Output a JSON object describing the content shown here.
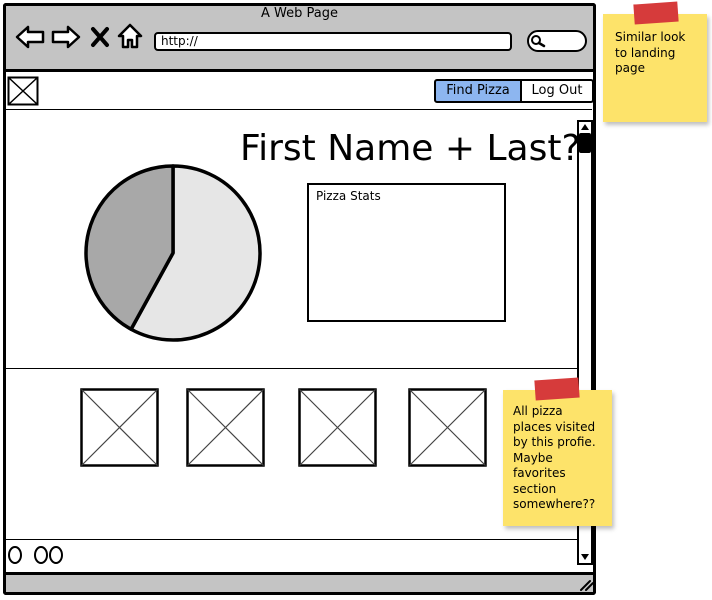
{
  "browser": {
    "title": "A Web Page",
    "url": "http://"
  },
  "navigation": {
    "find_pizza_label": "Find Pizza",
    "log_out_label": "Log Out"
  },
  "profile": {
    "name_heading": "First Name + Last?",
    "stats_box_label": "Pizza Stats"
  },
  "chart_data": {
    "type": "pie",
    "values": [
      58,
      42
    ],
    "colors": [
      "#e6e6e6",
      "#a8a8a8"
    ]
  },
  "sticky_notes": {
    "top_note": "Similar look to landing page",
    "bottom_note": "All pizza places visited by this profie. Maybe favorites section somewhere??"
  },
  "colors": {
    "chrome": "#c4c4c4",
    "active_button": "#8db6f0",
    "sticky": "#fde36a",
    "tape": "#d63b3b"
  }
}
